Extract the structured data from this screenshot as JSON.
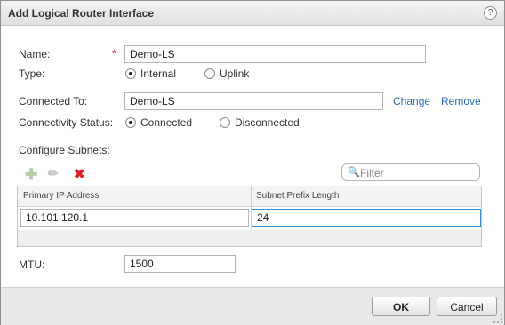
{
  "dialog": {
    "title": "Add Logical Router Interface",
    "help_glyph": "?"
  },
  "form": {
    "name_label": "Name:",
    "name_required_mark": "*",
    "name_value": "Demo-LS",
    "type_label": "Type:",
    "type_options": [
      "Internal",
      "Uplink"
    ],
    "type_selected": "Internal",
    "connected_to_label": "Connected To:",
    "connected_to_value": "Demo-LS",
    "change_link": "Change",
    "remove_link": "Remove",
    "connectivity_label": "Connectivity Status:",
    "connectivity_options": [
      "Connected",
      "Disconnected"
    ],
    "connectivity_selected": "Connected",
    "subnets_label": "Configure Subnets:",
    "mtu_label": "MTU:",
    "mtu_value": "1500"
  },
  "toolbar": {
    "add_icon": "plus-icon",
    "edit_icon": "pencil-icon",
    "delete_icon": "delete-x-icon",
    "filter_placeholder": "Filter"
  },
  "subnets_table": {
    "columns": [
      "Primary IP Address",
      "Subnet Prefix Length"
    ],
    "rows": [
      {
        "ip": "10.101.120.1",
        "prefix": "24"
      }
    ]
  },
  "footer": {
    "ok_label": "OK",
    "cancel_label": "Cancel"
  },
  "colors": {
    "link": "#2e6db4",
    "required": "#e0383e",
    "delete": "#d9262b",
    "focus_border": "#3a8ed8"
  }
}
